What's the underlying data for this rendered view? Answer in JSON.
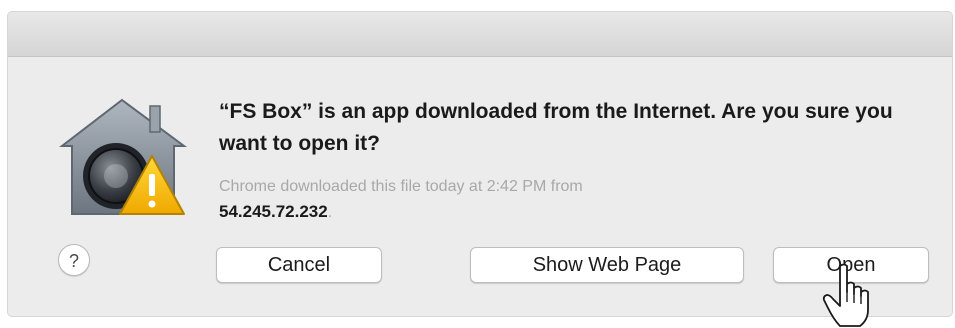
{
  "dialog": {
    "headline": "“FS Box” is an app downloaded from the Internet. Are you sure you want to open it?",
    "detail_prefix": "Chrome downloaded this file today at 2:42 PM from",
    "detail_source": "54.245.72.232",
    "detail_suffix": "."
  },
  "buttons": {
    "help_label": "?",
    "cancel_label": "Cancel",
    "show_web_page_label": "Show Web Page",
    "open_label": "Open"
  },
  "icons": {
    "app_icon": "gatekeeper-house-lock-icon",
    "warning_badge": "warning-triangle-icon",
    "cursor": "hand-pointer-icon"
  },
  "colors": {
    "dialog_background": "#ececec",
    "headline_text": "#1a1a1a",
    "detail_text": "#a8a8a8",
    "warning_yellow": "#f5c400"
  }
}
